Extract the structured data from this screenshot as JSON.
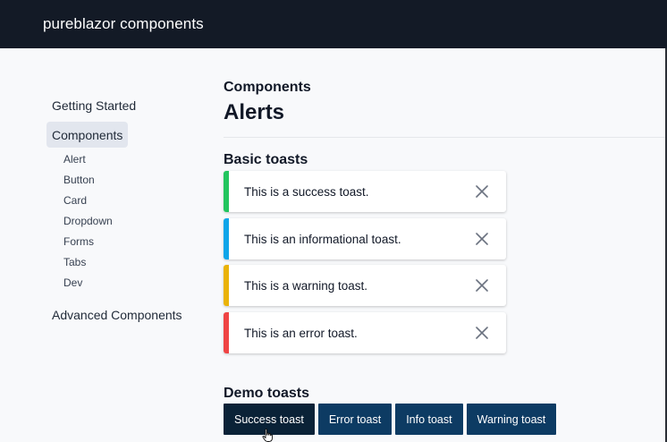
{
  "app": {
    "title": "pureblazor components"
  },
  "sidebar": {
    "top_items": [
      {
        "label": "Getting Started",
        "active": false
      },
      {
        "label": "Components",
        "active": true
      },
      {
        "label": "Advanced Components",
        "active": false
      }
    ],
    "sub_items": [
      {
        "label": "Alert"
      },
      {
        "label": "Button"
      },
      {
        "label": "Card"
      },
      {
        "label": "Dropdown"
      },
      {
        "label": "Forms"
      },
      {
        "label": "Tabs"
      },
      {
        "label": "Dev"
      }
    ]
  },
  "main": {
    "kicker": "Components",
    "title": "Alerts",
    "basic_heading": "Basic toasts",
    "toasts": [
      {
        "kind": "success",
        "message": "This is a success toast.",
        "color": "#22c55e",
        "close_icon": "close-icon"
      },
      {
        "kind": "info",
        "message": "This is an informational toast.",
        "color": "#0ea5e9",
        "close_icon": "close-icon"
      },
      {
        "kind": "warning",
        "message": "This is a warning toast.",
        "color": "#eab308",
        "close_icon": "close-icon"
      },
      {
        "kind": "error",
        "message": "This is an error toast.",
        "color": "#ef4444",
        "close_icon": "close-icon"
      }
    ],
    "demo_heading": "Demo toasts",
    "demo_buttons": [
      {
        "label": "Success toast",
        "state": "pressed"
      },
      {
        "label": "Error toast",
        "state": "normal"
      },
      {
        "label": "Info toast",
        "state": "normal"
      },
      {
        "label": "Warning toast",
        "state": "normal"
      }
    ]
  },
  "colors": {
    "topbar": "#131a26",
    "button": "#0d3b63",
    "button_pressed": "#0a2237",
    "active_nav": "#e2e6ee"
  }
}
